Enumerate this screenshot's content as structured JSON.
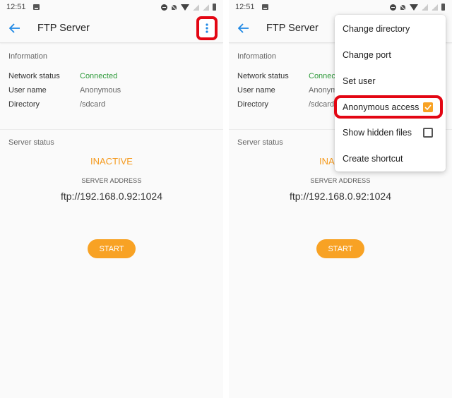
{
  "status_bar": {
    "time": "12:51",
    "left_icons": [
      "gallery-notification-icon"
    ],
    "right_icons": [
      "do-not-disturb-icon",
      "bell-off-icon",
      "wifi-icon",
      "no-signal-icon",
      "no-signal-icon",
      "battery-icon"
    ]
  },
  "app_bar": {
    "back_icon": "arrow-left-icon",
    "title": "FTP Server",
    "overflow_icon": "more-vertical-icon"
  },
  "information": {
    "heading": "Information",
    "rows": [
      {
        "label": "Network status",
        "value": "Connected"
      },
      {
        "label": "User name",
        "value": "Anonymous"
      },
      {
        "label": "Directory",
        "value": "/sdcard"
      }
    ]
  },
  "server_status": {
    "heading": "Server status",
    "state": "INACTIVE",
    "address_label": "SERVER ADDRESS",
    "address": "ftp://192.168.0.92:1024",
    "start_label": "START"
  },
  "overflow_menu": {
    "items": [
      {
        "label": "Change directory"
      },
      {
        "label": "Change port"
      },
      {
        "label": "Set user"
      },
      {
        "label": "Anonymous access",
        "checkbox": true,
        "checked": true
      },
      {
        "label": "Show hidden files",
        "checkbox": true,
        "checked": false
      },
      {
        "label": "Create shortcut"
      }
    ]
  },
  "colors": {
    "accent": "#f8a224",
    "status_inactive": "#f59a1e",
    "connected": "#2e9a3a",
    "link_blue": "#1e88e5",
    "highlight_red": "#e30613"
  }
}
